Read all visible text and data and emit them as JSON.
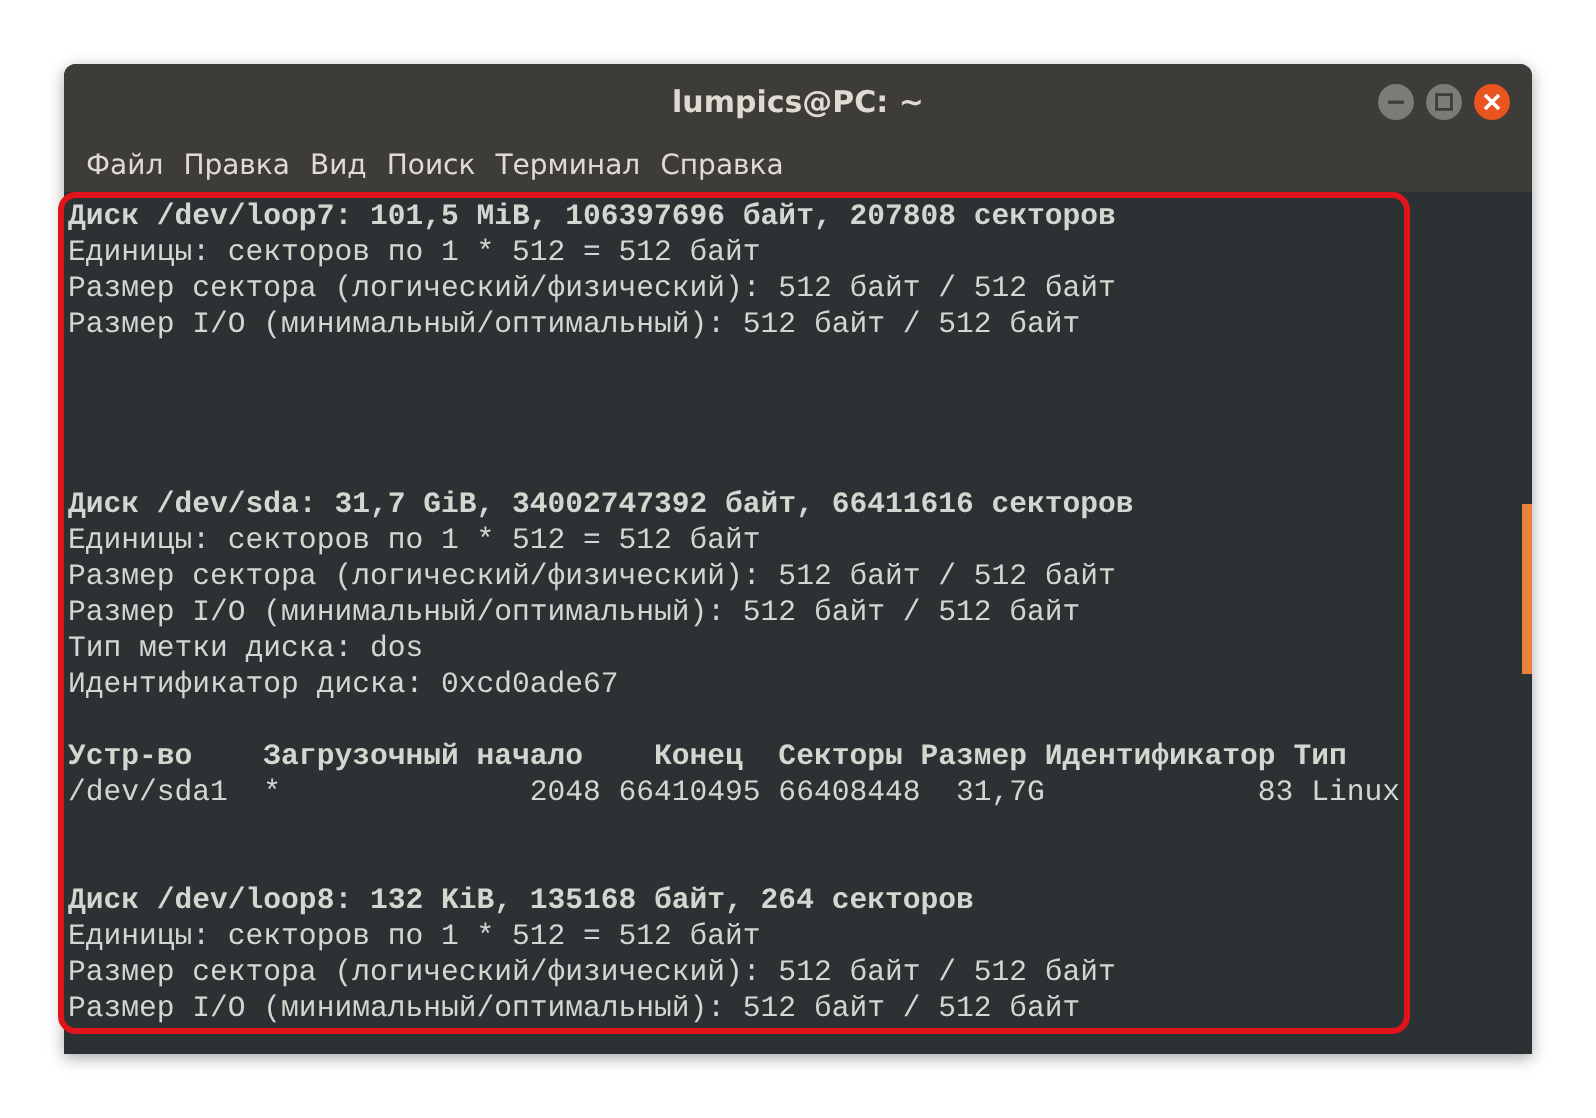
{
  "window": {
    "title": "lumpics@PC: ~"
  },
  "menu": [
    "Файл",
    "Правка",
    "Вид",
    "Поиск",
    "Терминал",
    "Справка"
  ],
  "terminal_lines": [
    {
      "kind": "text",
      "text": "Диск /dev/loop7: 101,5 MiB, 106397696 байт, 207808 секторов",
      "bold": true
    },
    {
      "kind": "text",
      "text": "Единицы: секторов по 1 * 512 = 512 байт",
      "bold": false
    },
    {
      "kind": "text",
      "text": "Размер сектора (логический/физический): 512 байт / 512 байт",
      "bold": false
    },
    {
      "kind": "text",
      "text": "Размер I/O (минимальный/оптимальный): 512 байт / 512 байт",
      "bold": false
    },
    {
      "kind": "blank"
    },
    {
      "kind": "blank"
    },
    {
      "kind": "blank"
    },
    {
      "kind": "blank"
    },
    {
      "kind": "text",
      "text": "Диск /dev/sda: 31,7 GiB, 34002747392 байт, 66411616 секторов",
      "bold": true
    },
    {
      "kind": "text",
      "text": "Единицы: секторов по 1 * 512 = 512 байт",
      "bold": false
    },
    {
      "kind": "text",
      "text": "Размер сектора (логический/физический): 512 байт / 512 байт",
      "bold": false
    },
    {
      "kind": "text",
      "text": "Размер I/O (минимальный/оптимальный): 512 байт / 512 байт",
      "bold": false
    },
    {
      "kind": "text",
      "text": "Тип метки диска: dos",
      "bold": false
    },
    {
      "kind": "text",
      "text": "Идентификатор диска: 0xcd0ade67",
      "bold": false
    },
    {
      "kind": "blank"
    },
    {
      "kind": "text",
      "text": "Устр-во    Загрузочный начало    Конец  Секторы Размер Идентификатор Тип",
      "bold": true
    },
    {
      "kind": "text",
      "text": "/dev/sda1  *              2048 66410495 66408448  31,7G            83 Linux",
      "bold": false
    },
    {
      "kind": "blank"
    },
    {
      "kind": "blank"
    },
    {
      "kind": "text",
      "text": "Диск /dev/loop8: 132 KiB, 135168 байт, 264 секторов",
      "bold": true
    },
    {
      "kind": "text",
      "text": "Единицы: секторов по 1 * 512 = 512 байт",
      "bold": false
    },
    {
      "kind": "text",
      "text": "Размер сектора (логический/физический): 512 байт / 512 байт",
      "bold": false
    },
    {
      "kind": "text",
      "text": "Размер I/O (минимальный/оптимальный): 512 байт / 512 байт",
      "bold": false
    }
  ]
}
